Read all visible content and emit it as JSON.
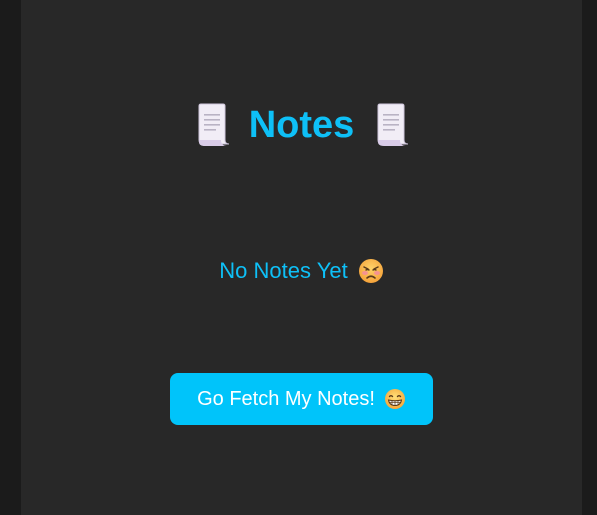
{
  "header": {
    "title": "Notes",
    "left_icon": "page-with-curl-icon",
    "right_icon": "page-with-curl-icon"
  },
  "empty_state": {
    "message": "No Notes Yet",
    "icon": "disappointed-face-icon"
  },
  "actions": {
    "fetch_label": "Go Fetch My Notes!",
    "fetch_icon": "grinning-face-icon"
  },
  "colors": {
    "page_background": "#1b1b1b",
    "panel_background": "#282828",
    "accent": "#0ec0f7",
    "button_background": "#00c4fa",
    "button_text": "#ffffff"
  }
}
